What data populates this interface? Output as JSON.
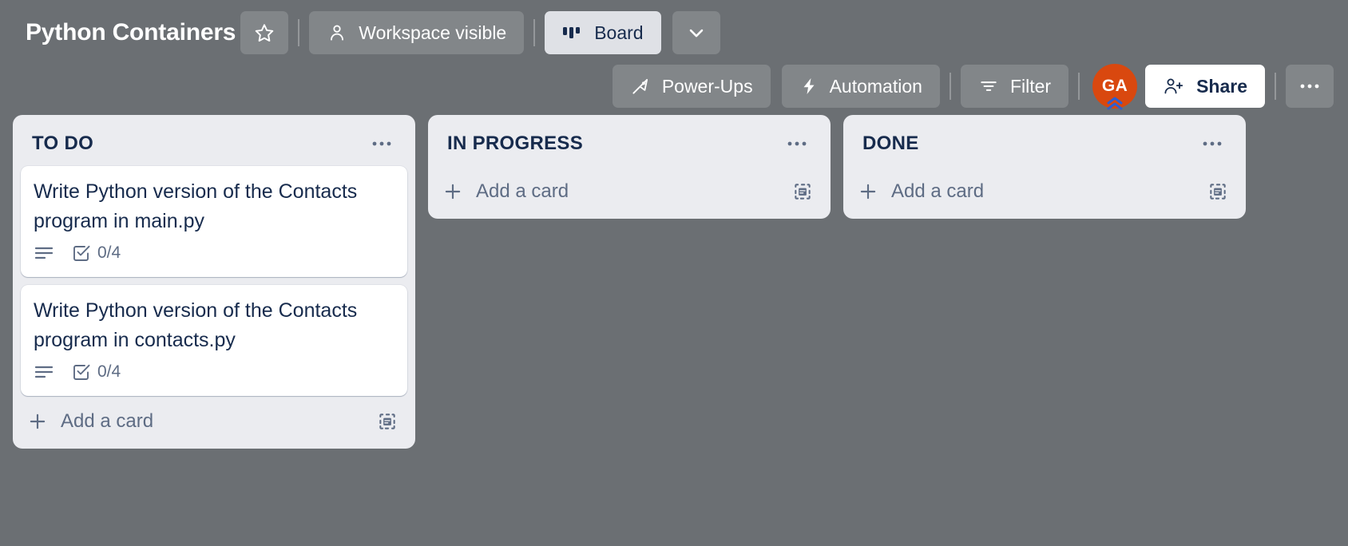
{
  "header": {
    "board_title": "Python Containers",
    "star_icon": "star-icon",
    "visibility_label": "Workspace visible",
    "visibility_icon": "workspace-members-icon",
    "view_label": "Board",
    "view_icon": "board-columns-icon",
    "view_dropdown_icon": "chevron-down-icon"
  },
  "toolbar": {
    "powerups_label": "Power-Ups",
    "powerups_icon": "rocket-icon",
    "automation_label": "Automation",
    "automation_icon": "lightning-bolt-icon",
    "filter_label": "Filter",
    "filter_icon": "filter-icon",
    "avatar_initials": "GA",
    "avatar_color": "#d9480f",
    "avatar_badge_icon": "premium-chevrons-icon",
    "share_label": "Share",
    "share_icon": "person-add-icon",
    "more_label": "•••",
    "more_icon": "ellipsis-icon"
  },
  "colors": {
    "board_background": "#6b6f73",
    "list_background": "#ebecf0",
    "card_background": "#ffffff",
    "text_primary": "#172b4d",
    "text_muted": "#5e6c84"
  },
  "lists": [
    {
      "title": "TO DO",
      "menu_icon": "list-actions-ellipsis-icon",
      "add_card_label": "Add a card",
      "add_card_icon": "plus-icon",
      "template_icon": "card-template-icon",
      "cards": [
        {
          "title": "Write Python version of the Contacts program in main.py",
          "badges": [
            {
              "type": "description",
              "icon": "description-icon",
              "label": ""
            },
            {
              "type": "checklist",
              "icon": "checklist-icon",
              "label": "0/4"
            }
          ]
        },
        {
          "title": "Write Python version of the Contacts program in contacts.py",
          "badges": [
            {
              "type": "description",
              "icon": "description-icon",
              "label": ""
            },
            {
              "type": "checklist",
              "icon": "checklist-icon",
              "label": "0/4"
            }
          ]
        }
      ]
    },
    {
      "title": "IN PROGRESS",
      "menu_icon": "list-actions-ellipsis-icon",
      "add_card_label": "Add a card",
      "add_card_icon": "plus-icon",
      "template_icon": "card-template-icon",
      "cards": []
    },
    {
      "title": "DONE",
      "menu_icon": "list-actions-ellipsis-icon",
      "add_card_label": "Add a card",
      "add_card_icon": "plus-icon",
      "template_icon": "card-template-icon",
      "cards": []
    }
  ]
}
